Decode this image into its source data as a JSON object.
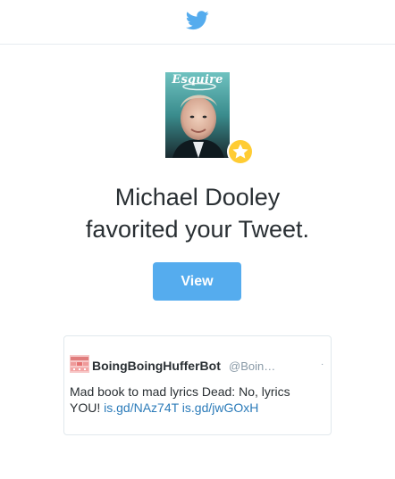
{
  "header": {
    "logo_icon": "twitter-bird-icon",
    "brand_color": "#55acee"
  },
  "notification": {
    "avatar_image": "esquire-cover-portrait",
    "avatar_cover_title": "Esquire",
    "badge_icon": "favorite-star-icon",
    "badge_color": "#ffcc33",
    "name": "Michael Dooley",
    "action": "favorited your Tweet."
  },
  "actions": {
    "view_label": "View",
    "button_color": "#55acee"
  },
  "tweet": {
    "avatar_icon": "boingboing-avatar-icon",
    "author_name": "BoingBoingHufferBot",
    "author_handle": "@Boin…",
    "menu_dot": "·",
    "text_prefix": "Mad book to mad lyrics Dead: No, lyrics YOU!",
    "links": [
      "is.gd/NAz74T",
      "is.gd/jwGOxH"
    ],
    "link_color": "#2b7bb9"
  }
}
